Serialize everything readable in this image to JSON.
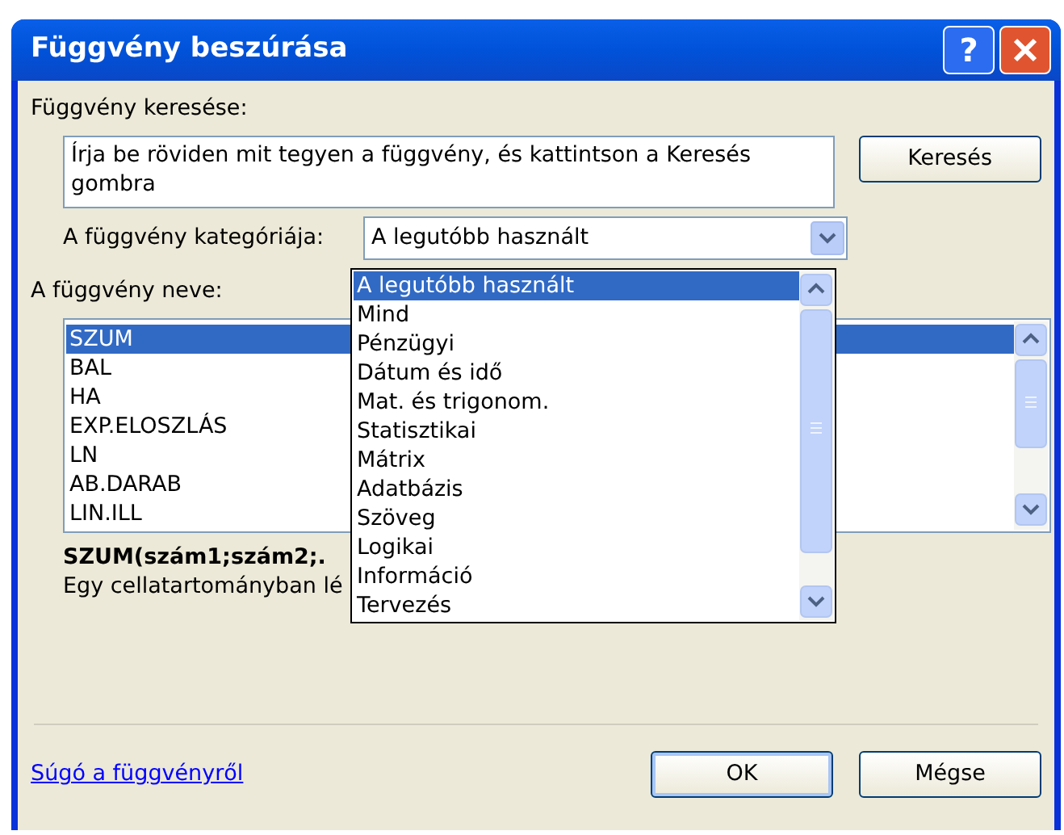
{
  "window": {
    "title": "Függvény beszúrása"
  },
  "title_buttons": [
    {
      "kind": "help",
      "label": "?"
    },
    {
      "kind": "close"
    }
  ],
  "search": {
    "label": "Függvény keresése:",
    "value": "Írja be röviden mit tegyen a függvény, és kattintson a Keresés gombra",
    "button": "Keresés"
  },
  "category": {
    "label": "A függvény kategóriája:",
    "value": "A legutóbb használt",
    "expanded": true,
    "options": [
      {
        "label": "A legutóbb használt",
        "selected": true
      },
      {
        "label": "Mind",
        "selected": false
      },
      {
        "label": "Pénzügyi",
        "selected": false
      },
      {
        "label": "Dátum és idő",
        "selected": false
      },
      {
        "label": "Mat. és trigonom.",
        "selected": false
      },
      {
        "label": "Statisztikai",
        "selected": false
      },
      {
        "label": "Mátrix",
        "selected": false
      },
      {
        "label": "Adatbázis",
        "selected": false
      },
      {
        "label": "Szöveg",
        "selected": false
      },
      {
        "label": "Logikai",
        "selected": false
      },
      {
        "label": "Információ",
        "selected": false
      },
      {
        "label": "Tervezés",
        "selected": false
      }
    ]
  },
  "functions": {
    "label": "A függvény neve:",
    "items": [
      {
        "label": "SZUM",
        "selected": true
      },
      {
        "label": "BAL",
        "selected": false
      },
      {
        "label": "HA",
        "selected": false
      },
      {
        "label": "EXP.ELOSZLÁS",
        "selected": false
      },
      {
        "label": "LN",
        "selected": false
      },
      {
        "label": "AB.DARAB",
        "selected": false
      },
      {
        "label": "LIN.ILL",
        "selected": false
      }
    ]
  },
  "signature": "SZUM(szám1;szám2;.",
  "description": "Egy cellatartományban lé",
  "help_link": "Súgó a függvényről",
  "buttons": [
    {
      "label": "OK",
      "default": true
    },
    {
      "label": "Mégse",
      "default": false
    }
  ]
}
